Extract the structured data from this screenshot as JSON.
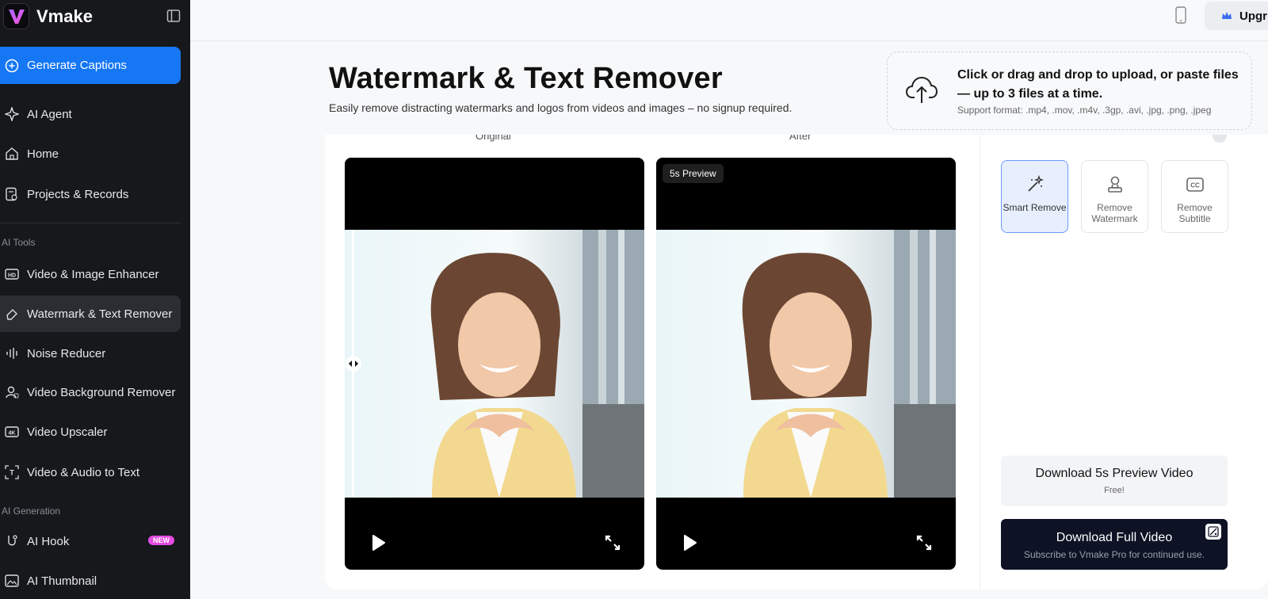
{
  "app": {
    "name": "Vmake"
  },
  "sidebar": {
    "generate_label": "Generate Captions",
    "items": [
      {
        "label": "AI Agent",
        "icon": "sparkle-icon"
      },
      {
        "label": "Home",
        "icon": "home-icon"
      },
      {
        "label": "Projects & Records",
        "icon": "records-icon"
      }
    ],
    "ai_tools_label": "AI Tools",
    "tools": [
      {
        "label": "Video & Image Enhancer",
        "icon": "hd-icon"
      },
      {
        "label": "Watermark & Text Remover",
        "icon": "eraser-icon",
        "active": true
      },
      {
        "label": "Noise Reducer",
        "icon": "waveform-icon"
      },
      {
        "label": "Video Background Remover",
        "icon": "person-cutout-icon"
      },
      {
        "label": "Video Upscaler",
        "icon": "4k-icon"
      },
      {
        "label": "Video & Audio to Text",
        "icon": "text-frame-icon"
      }
    ],
    "ai_generation_label": "AI Generation",
    "generation": [
      {
        "label": "AI Hook",
        "icon": "hook-icon",
        "badge": "NEW"
      },
      {
        "label": "AI Thumbnail",
        "icon": "thumbnail-icon"
      }
    ]
  },
  "topbar": {
    "upgrade_label": "Upgr"
  },
  "header": {
    "title": "Watermark & Text Remover",
    "subtitle": "Easily remove distracting watermarks and logos from videos and images – no signup required."
  },
  "upload": {
    "title": "Click or drag and drop to upload, or paste files — up to 3 files at a time.",
    "hint": "Support format: .mp4, .mov, .m4v, .3gp, .avi, .jpg, .png, .jpeg"
  },
  "compare": {
    "original_label": "Original",
    "after_label": "After",
    "preview_tag": "5s Preview"
  },
  "tools": [
    {
      "label": "Smart Remove",
      "active": true
    },
    {
      "label": "Remove Watermark",
      "active": false
    },
    {
      "label": "Remove Subtitle",
      "active": false
    }
  ],
  "downloads": {
    "preview_title": "Download 5s Preview Video",
    "preview_sub": "Free!",
    "full_title": "Download Full Video",
    "full_sub": "Subscribe to Vmake Pro for continued use."
  },
  "colors": {
    "accent": "#1677f5",
    "sidebar_bg": "#16181c",
    "download_full_bg": "#0d1224",
    "badge_new": "#e54be0"
  }
}
